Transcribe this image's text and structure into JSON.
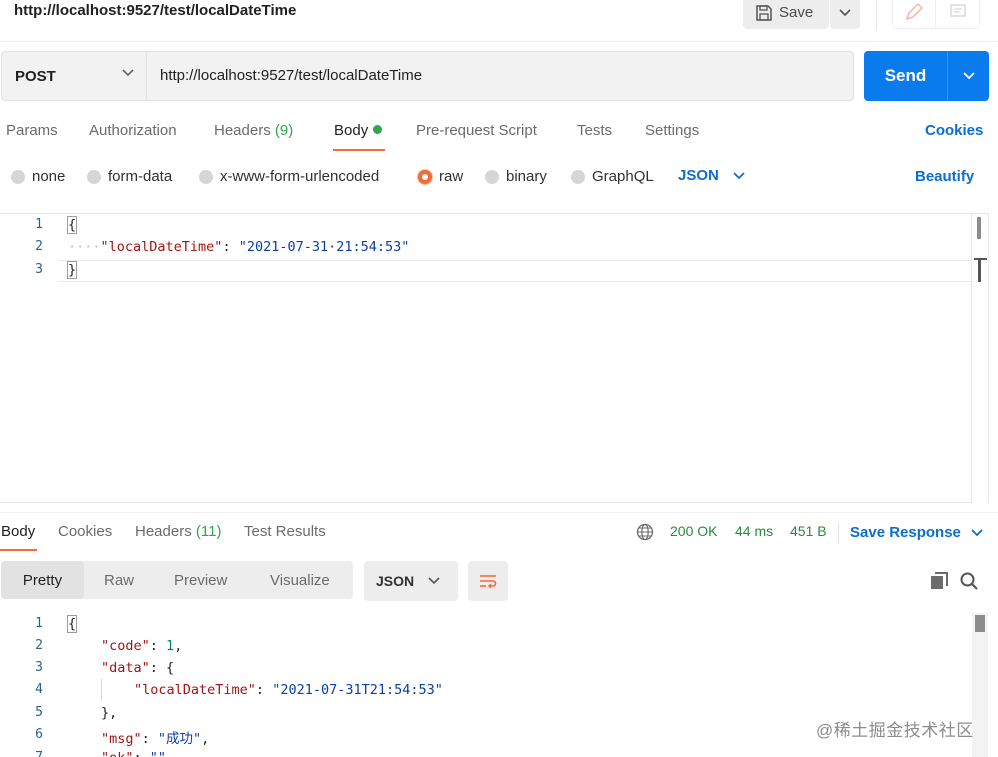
{
  "header": {
    "title": "http://localhost:9527/test/localDateTime",
    "save_label": "Save",
    "save_icon": "floppy-disk-icon",
    "edit_icon": "pencil-icon",
    "comment_icon": "comment-icon"
  },
  "request": {
    "method": "POST",
    "url": "http://localhost:9527/test/localDateTime",
    "send_label": "Send"
  },
  "request_tabs": {
    "params": "Params",
    "authorization": "Authorization",
    "headers": "Headers",
    "headers_count": "(9)",
    "body": "Body",
    "prerequest": "Pre-request Script",
    "tests": "Tests",
    "settings": "Settings",
    "cookies": "Cookies"
  },
  "body_types": {
    "none": "none",
    "form_data": "form-data",
    "urlencoded": "x-www-form-urlencoded",
    "raw": "raw",
    "binary": "binary",
    "graphql": "GraphQL",
    "selected": "raw",
    "language": "JSON",
    "beautify": "Beautify"
  },
  "request_body": {
    "lines": [
      {
        "n": "1",
        "text": "{"
      },
      {
        "n": "2",
        "indent": "····",
        "key": "\"localDateTime\"",
        "sep": ": ",
        "value": "\"2021-07-31·21:54:53\""
      },
      {
        "n": "3",
        "text": "}"
      }
    ]
  },
  "response_tabs": {
    "body": "Body",
    "cookies": "Cookies",
    "headers": "Headers",
    "headers_count": "(11)",
    "test_results": "Test Results",
    "status": "200 OK",
    "time": "44 ms",
    "size": "451 B",
    "save_response": "Save Response"
  },
  "response_toolbar": {
    "views": [
      "Pretty",
      "Raw",
      "Preview",
      "Visualize"
    ],
    "active_view": "Pretty",
    "format": "JSON"
  },
  "response_body": {
    "lines": [
      {
        "n": "1",
        "text": "{"
      },
      {
        "n": "2",
        "key": "\"code\"",
        "sep": ": ",
        "num": "1",
        "tail": ","
      },
      {
        "n": "3",
        "key": "\"data\"",
        "sep": ": ",
        "tail": "{"
      },
      {
        "n": "4",
        "key": "\"localDateTime\"",
        "sep": ": ",
        "value": "\"2021-07-31T21:54:53\""
      },
      {
        "n": "5",
        "text": "},"
      },
      {
        "n": "6",
        "key": "\"msg\"",
        "sep": ": ",
        "value": "\"成功\"",
        "tail": ","
      },
      {
        "n": "7",
        "key": "\"ok\"",
        "sep": ": ",
        "value": "\"\""
      }
    ]
  },
  "watermark": "@稀土掘金技术社区",
  "colors": {
    "send": "#097bed",
    "accent": "#f26b3a",
    "link": "#0b6ed0",
    "status": "#2a8a3e"
  }
}
